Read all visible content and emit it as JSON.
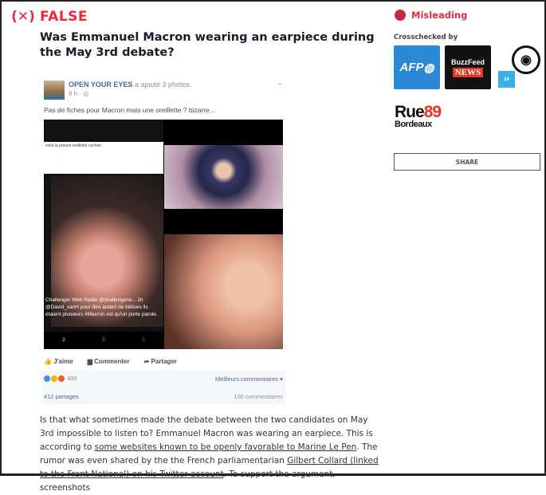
{
  "verdict": {
    "label": "FALSE",
    "icon": "x-in-brackets-icon",
    "color": "#f0283c"
  },
  "title": "Was Emmanuel Macron wearing an earpiece during the May 3rd debate?",
  "post": {
    "author": "OPEN YOUR EYES",
    "action": "a ajouté 3 photos.",
    "time": "8 h · ",
    "message": "Pas de fiches pour Macron mais une oreillette ? bizarre ..",
    "photo1": {
      "caption": "voilà la preuve oreillette cachée",
      "tweet": "Challenger Web Radio @challengerw... 1h @David_vanH pour dire autant de bêtises ils étaient plusieurs #Macron est qu'un porte parole.",
      "reply": "2",
      "retweet": "5",
      "like": "2"
    },
    "actions": {
      "like": "J'aime",
      "comment": "Commenter",
      "share": "Partager"
    },
    "reactions": "490",
    "sort": "Meilleurs commentaires",
    "shares": "412 partages",
    "comments": "106 commentaires"
  },
  "body": {
    "p1": "Is that what sometimes made the debate between the two candidates on May 3rd impossible to listen to? Emmanuel Macron was wearing an earpiece. This is according to ",
    "link1": "some websites known to be openly favorable to Marine Le Pen",
    "p2": ". The rumor was even shared by the the French parliamentarian ",
    "link2": "Gilbert Collard (linked to the Front National) on his Twitter account",
    "p3": ". To support the argument, screenshots"
  },
  "sidebar": {
    "rating": "Misleading",
    "crosschecked": "Crosschecked by",
    "logos": {
      "afp": "AFP",
      "buzzfeed_top": "BuzzFeed",
      "buzzfeed_bottom": "NEWS",
      "france24": "24",
      "rue_a": "Rue",
      "rue_num": "89",
      "rue_b": "Bordeaux"
    },
    "share": "SHARE"
  }
}
